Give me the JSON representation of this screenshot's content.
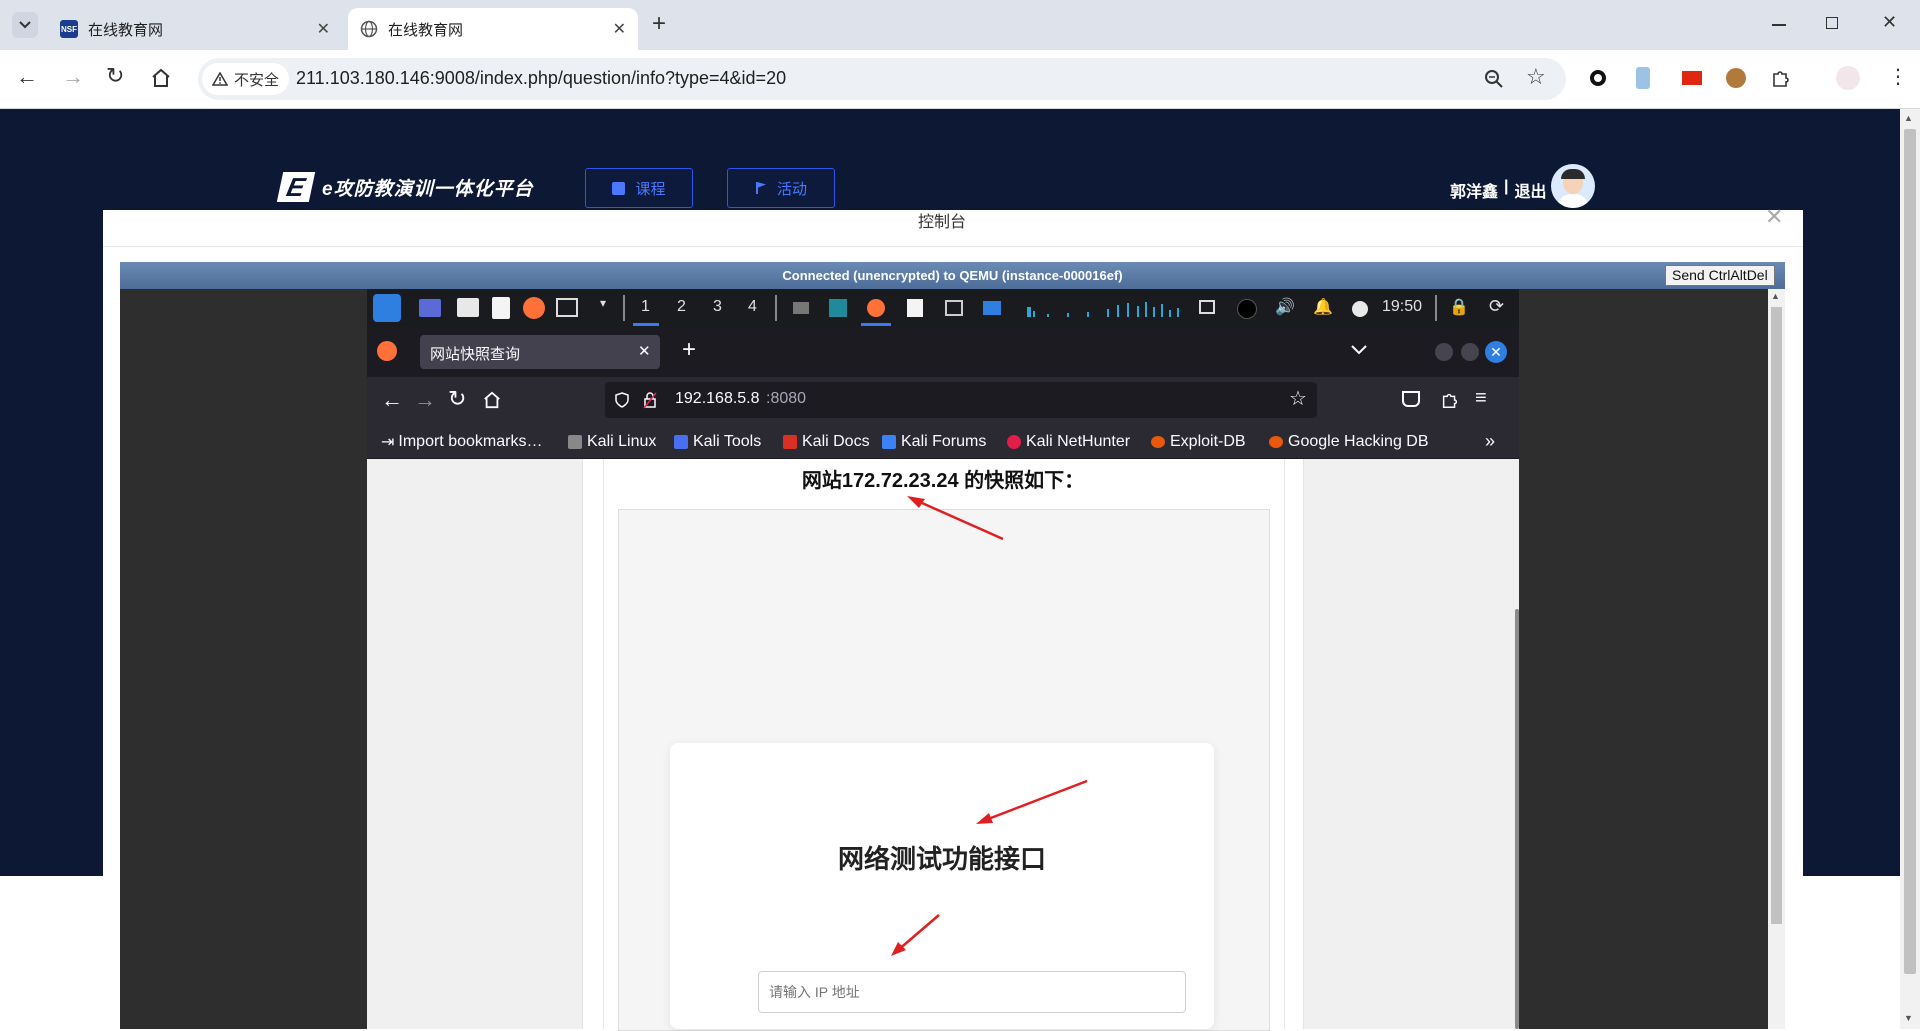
{
  "browser": {
    "tabs": [
      {
        "title": "在线教育网"
      },
      {
        "title": "在线教育网"
      }
    ],
    "security_label": "不安全",
    "url": "211.103.180.146:9008/index.php/question/info?type=4&id=20"
  },
  "site": {
    "logo_text": "e攻防教演训一体化平台",
    "nav": {
      "course": "课程",
      "activity": "活动"
    },
    "user": {
      "name": "郭洋鑫",
      "separator": "|",
      "logout": "退出"
    }
  },
  "modal": {
    "title": "控制台",
    "vnc_status": "Connected (unencrypted) to QEMU (instance-000016ef)",
    "send_button": "Send CtrlAltDel"
  },
  "kali": {
    "workspaces": [
      "1",
      "2",
      "3",
      "4"
    ],
    "clock": "19:50",
    "firefox": {
      "tab_title": "网站快照查询",
      "url_host": "192.168.5.8",
      "url_port": ":8080",
      "bookmarks": [
        "Import bookmarks…",
        "Kali Linux",
        "Kali Tools",
        "Kali Docs",
        "Kali Forums",
        "Kali NetHunter",
        "Exploit-DB",
        "Google Hacking DB"
      ]
    },
    "page": {
      "heading": "网站172.72.23.24 的快照如下：",
      "card_title": "网络测试功能接口",
      "ip_placeholder": "请输入 IP 地址"
    }
  },
  "colors": {
    "site_bg": "#0c1834",
    "nav_accent": "#2f54eb",
    "vnc_bar": "#5a7ba6",
    "arrow": "#e02020"
  }
}
